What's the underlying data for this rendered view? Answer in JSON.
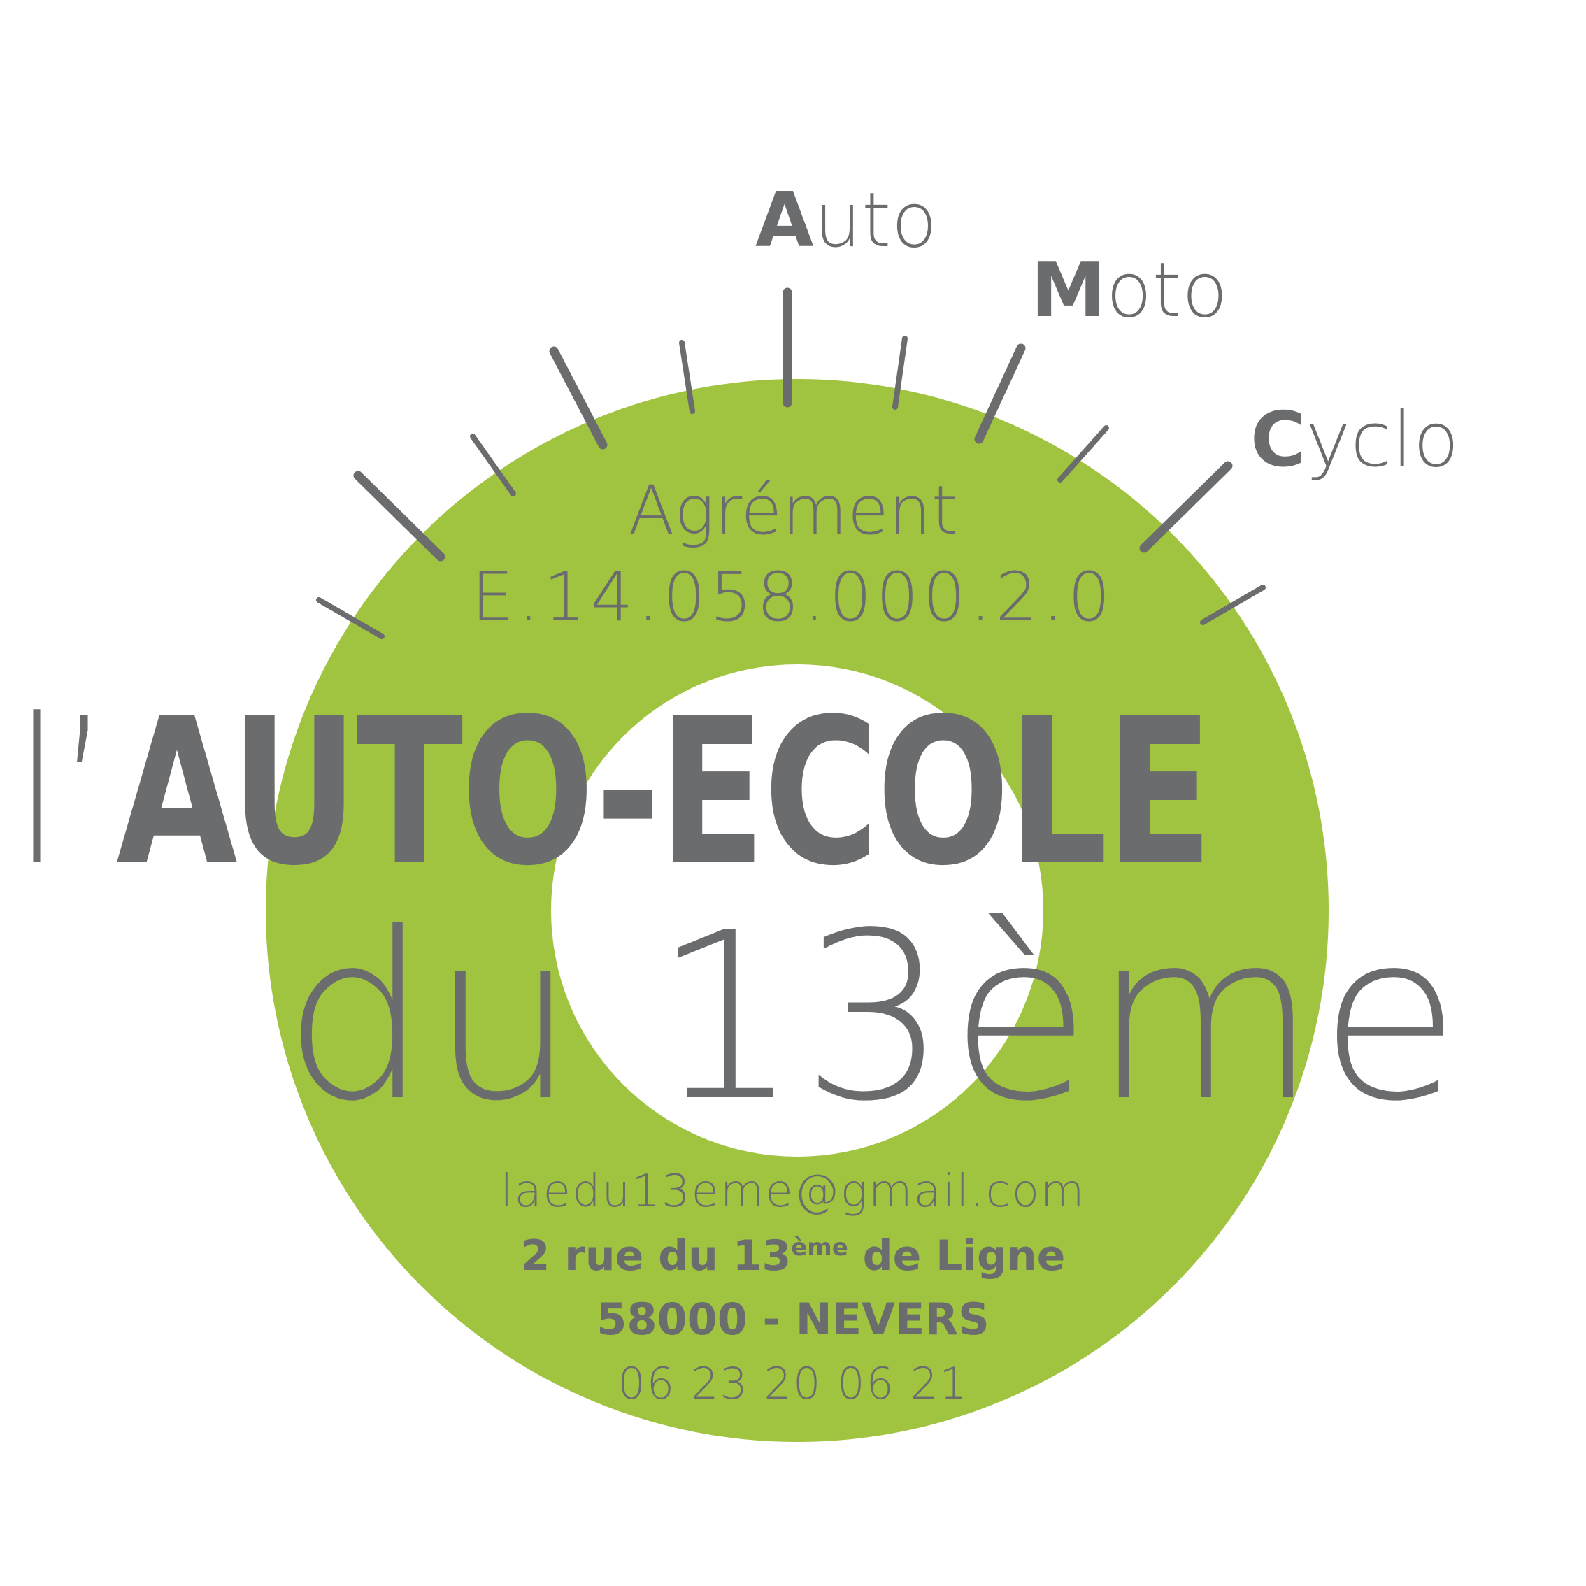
{
  "colors": {
    "green": "#a0c43f",
    "gray": "#6b6c6e",
    "white": "#ffffff"
  },
  "categories": [
    {
      "initial": "A",
      "rest": "uto"
    },
    {
      "initial": "M",
      "rest": "oto"
    },
    {
      "initial": "C",
      "rest": "yclo"
    }
  ],
  "agrement": {
    "label": "Agrément",
    "number": "E.14.058.000.2.0"
  },
  "title": {
    "prefix": "l’",
    "main": "AUTO-ECOLE",
    "line2": "du 13ème"
  },
  "contact": {
    "email": "laedu13eme@gmail.com",
    "address_start": "2 rue du 13",
    "address_sup": "ème",
    "address_end": " de Ligne",
    "city": "58000 - NEVERS",
    "phone": "06 23 20 06 21"
  },
  "logo": {
    "icon": "speedometer-gauge-icon"
  }
}
